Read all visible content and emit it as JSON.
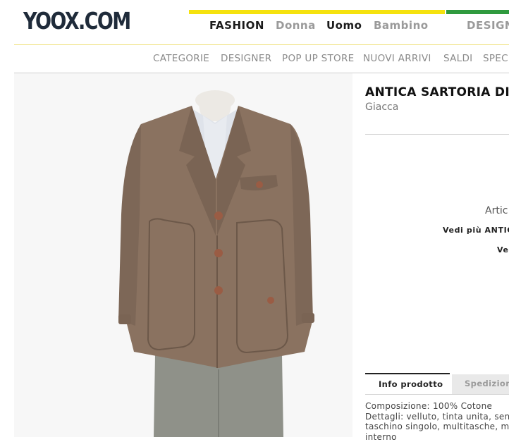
{
  "header": {
    "logo": "YOOX.COM",
    "top_nav": {
      "fashion": "FASHION",
      "donna": "Donna",
      "uomo": "Uomo",
      "bambino": "Bambino",
      "design": "DESIGN"
    },
    "sub_nav": [
      "CATEGORIE",
      "DESIGNER",
      "POP UP STORE",
      "NUOVI ARRIVI",
      "SALDI",
      "SPECI"
    ]
  },
  "product": {
    "brand_title": "ANTICA SARTORIA DI M",
    "category": "Giacca",
    "artic_label": "Artic",
    "see_more_brand": "Vedi più ANTIC",
    "see_more_2": "Ve"
  },
  "tabs": {
    "info": "Info prodotto",
    "shipping": "Spedizion"
  },
  "info": {
    "composition": "Composizione:  100% Cotone",
    "details_1": "Dettagli: velluto, tinta unita, senz",
    "details_2": "taschino singolo, multitasche, ma",
    "details_3": "interno"
  },
  "colors": {
    "accent_yellow": "#f5e20e",
    "accent_green": "#2f9a3e",
    "jacket": "#8a7260"
  }
}
